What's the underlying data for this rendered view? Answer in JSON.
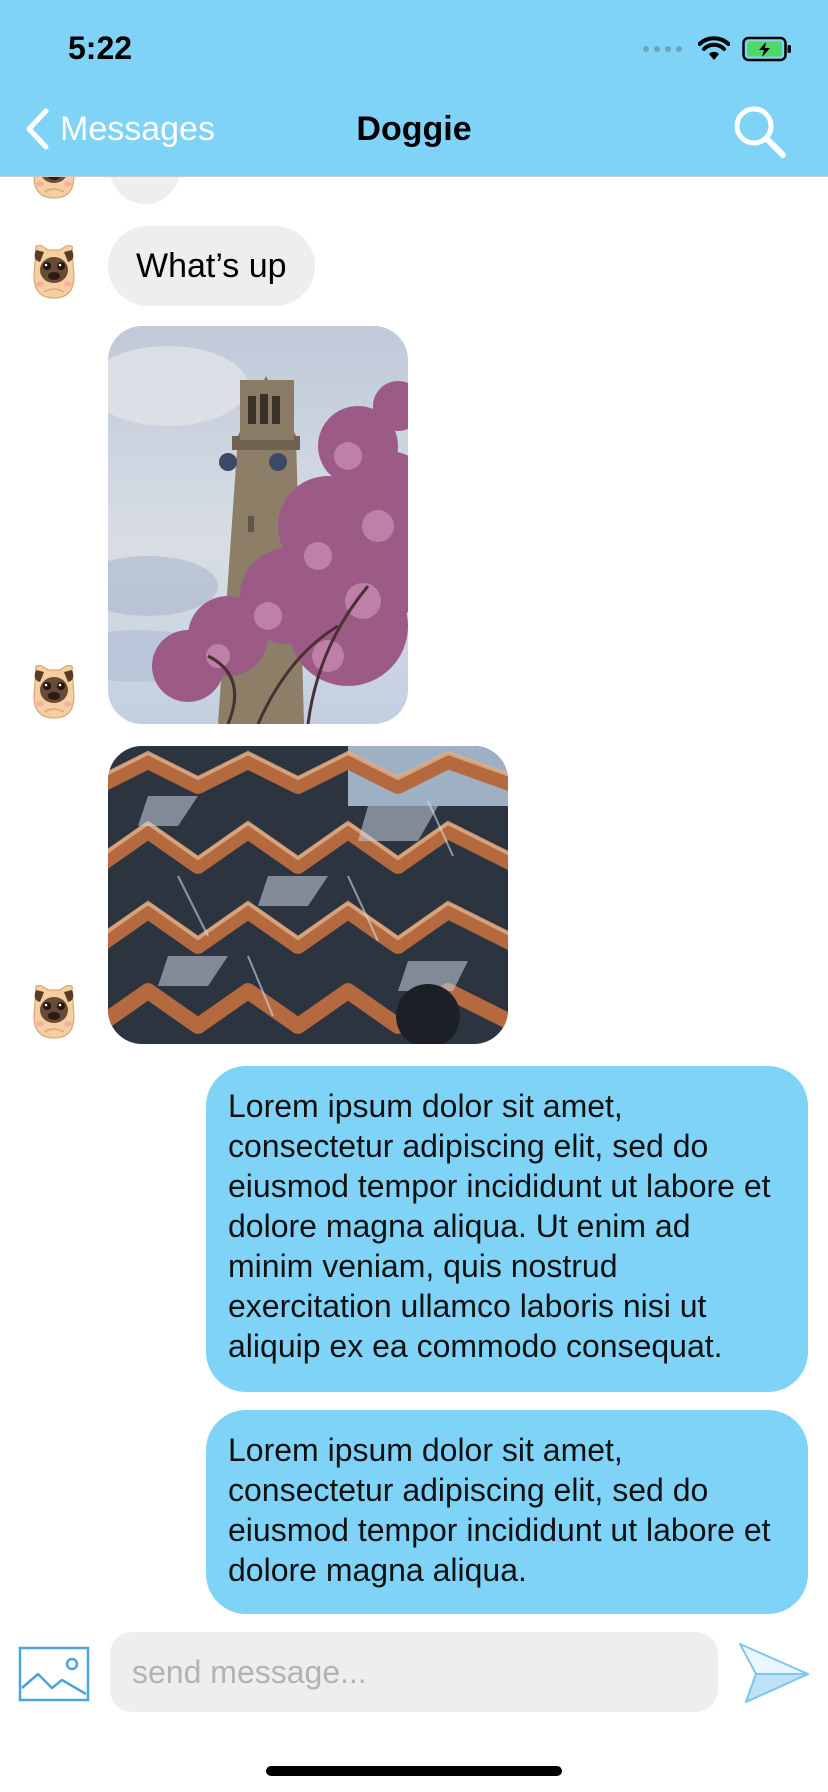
{
  "status_bar": {
    "time": "5:22"
  },
  "nav": {
    "back_label": "Messages",
    "title": "Doggie"
  },
  "messages": {
    "incoming_text": "What’s up",
    "outgoing": [
      "Lorem ipsum dolor sit amet, consectetur adipiscing elit, sed do eiusmod tempor incididunt ut labore et dolore magna aliqua. Ut enim ad minim veniam, quis nostrud exercitation ullamco laboris nisi ut aliquip ex ea commodo consequat.",
      "Lorem ipsum dolor sit amet, consectetur adipiscing elit, sed do eiusmod tempor incididunt ut labore et dolore magna aliqua."
    ]
  },
  "composer": {
    "placeholder": "send message..."
  },
  "icons": {
    "back": "chevron-left-icon",
    "search": "search-icon",
    "attach": "image-icon",
    "send": "paper-plane-icon",
    "avatar": "pug-avatar-icon"
  },
  "colors": {
    "accent": "#7fd3f7",
    "incoming_bubble": "#eeeeee",
    "outgoing_bubble": "#7fd3f7",
    "attach_icon": "#4aa3d9"
  }
}
